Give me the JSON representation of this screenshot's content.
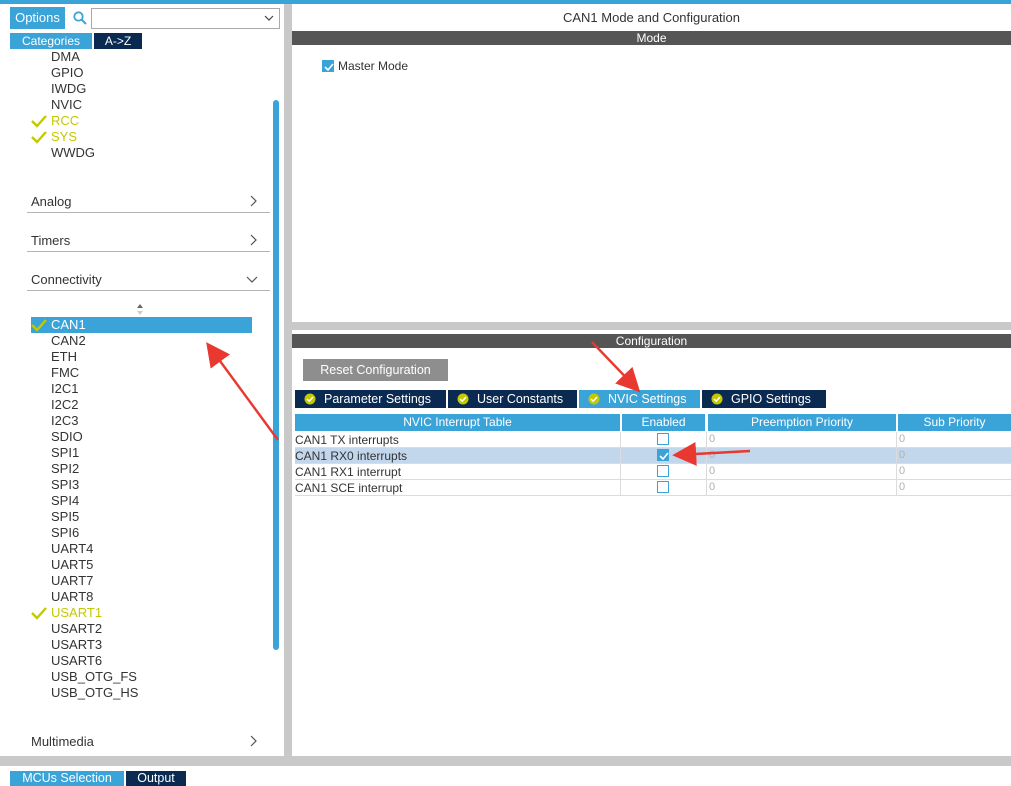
{
  "left": {
    "options_label": "Options",
    "search_value": "",
    "tabs": {
      "categories": "Categories",
      "az": "A->Z"
    },
    "system_core_items": [
      {
        "label": "DMA",
        "ok": false
      },
      {
        "label": "GPIO",
        "ok": false
      },
      {
        "label": "IWDG",
        "ok": false
      },
      {
        "label": "NVIC",
        "ok": false
      },
      {
        "label": "RCC",
        "ok": true
      },
      {
        "label": "SYS",
        "ok": true
      },
      {
        "label": "WWDG",
        "ok": false
      }
    ],
    "categories": {
      "analog": "Analog",
      "timers": "Timers",
      "connectivity": "Connectivity",
      "multimedia": "Multimedia"
    },
    "connectivity_items": [
      {
        "label": "CAN1",
        "ok": true,
        "selected": true
      },
      {
        "label": "CAN2"
      },
      {
        "label": "ETH"
      },
      {
        "label": "FMC"
      },
      {
        "label": "I2C1"
      },
      {
        "label": "I2C2"
      },
      {
        "label": "I2C3"
      },
      {
        "label": "SDIO"
      },
      {
        "label": "SPI1"
      },
      {
        "label": "SPI2"
      },
      {
        "label": "SPI3"
      },
      {
        "label": "SPI4"
      },
      {
        "label": "SPI5"
      },
      {
        "label": "SPI6"
      },
      {
        "label": "UART4"
      },
      {
        "label": "UART5"
      },
      {
        "label": "UART7"
      },
      {
        "label": "UART8"
      },
      {
        "label": "USART1",
        "ok": true
      },
      {
        "label": "USART2"
      },
      {
        "label": "USART3"
      },
      {
        "label": "USART6"
      },
      {
        "label": "USB_OTG_FS"
      },
      {
        "label": "USB_OTG_HS"
      }
    ]
  },
  "right": {
    "title": "CAN1 Mode and Configuration",
    "mode_header": "Mode",
    "master_mode": {
      "label": "Master Mode",
      "checked": true
    },
    "config_header": "Configuration",
    "reset_label": "Reset Configuration",
    "tabs": [
      {
        "label": "Parameter Settings",
        "active": false
      },
      {
        "label": "User Constants",
        "active": false
      },
      {
        "label": "NVIC Settings",
        "active": true
      },
      {
        "label": "GPIO Settings",
        "active": false
      }
    ],
    "table": {
      "headers": [
        "NVIC Interrupt Table",
        "Enabled",
        "Preemption Priority",
        "Sub Priority"
      ],
      "rows": [
        {
          "name": "CAN1 TX interrupts",
          "enabled": false,
          "preemption": "0",
          "sub": "0"
        },
        {
          "name": "CAN1 RX0 interrupts",
          "enabled": true,
          "preemption": "0",
          "sub": "0"
        },
        {
          "name": "CAN1 RX1 interrupt",
          "enabled": false,
          "preemption": "0",
          "sub": "0"
        },
        {
          "name": "CAN1 SCE interrupt",
          "enabled": false,
          "preemption": "0",
          "sub": "0"
        }
      ]
    }
  },
  "bottom": {
    "mcu_selection": "MCUs Selection",
    "output": "Output"
  },
  "colors": {
    "accent": "#3aa3d8",
    "dark_tab": "#0a2a52",
    "ok_green": "#c4c800",
    "header_grey": "#555555"
  }
}
